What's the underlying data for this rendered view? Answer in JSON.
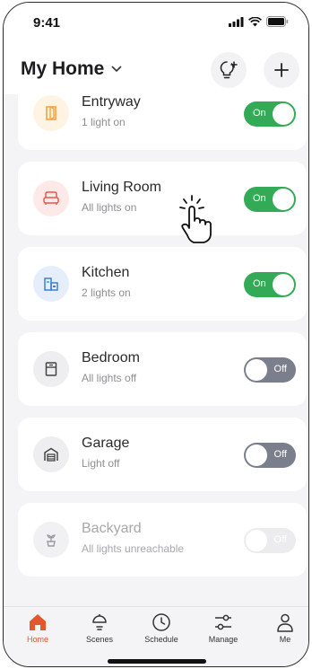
{
  "status_bar": {
    "time": "9:41"
  },
  "header": {
    "title": "My Home"
  },
  "rooms": [
    {
      "name": "Entryway",
      "status": "1 light on",
      "toggle": "On",
      "state": "on",
      "icon": "door-icon",
      "accent": "#f5a23a"
    },
    {
      "name": "Living Room",
      "status": "All lights on",
      "toggle": "On",
      "state": "on",
      "icon": "sofa-icon",
      "accent": "#e8574f"
    },
    {
      "name": "Kitchen",
      "status": "2 lights on",
      "toggle": "On",
      "state": "on",
      "icon": "kitchen-icon",
      "accent": "#3f7fd8"
    },
    {
      "name": "Bedroom",
      "status": "All lights off",
      "toggle": "Off",
      "state": "off",
      "icon": "wardrobe-icon",
      "accent": "#444444"
    },
    {
      "name": "Garage",
      "status": "Light off",
      "toggle": "Off",
      "state": "off",
      "icon": "garage-icon",
      "accent": "#444444"
    },
    {
      "name": "Backyard",
      "status": "All lights unreachable",
      "toggle": "Off",
      "state": "unreachable",
      "icon": "plant-icon",
      "accent": "#9a9aa0"
    }
  ],
  "tabs": [
    {
      "label": "Home",
      "icon": "home-icon",
      "active": true
    },
    {
      "label": "Scenes",
      "icon": "lamp-icon",
      "active": false
    },
    {
      "label": "Schedule",
      "icon": "clock-icon",
      "active": false
    },
    {
      "label": "Manage",
      "icon": "sliders-icon",
      "active": false
    },
    {
      "label": "Me",
      "icon": "person-icon",
      "active": false
    }
  ],
  "colors": {
    "on": "#33aa55",
    "off": "#7b7f8c",
    "active_tab": "#e4572e"
  }
}
